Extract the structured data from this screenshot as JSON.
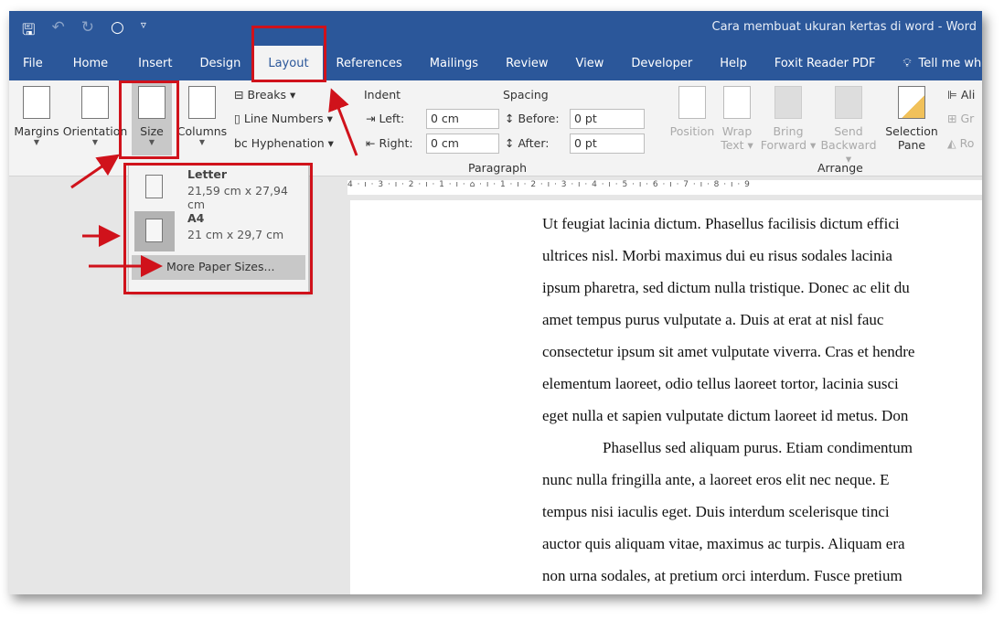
{
  "window": {
    "title": "Cara membuat ukuran kertas di word  -  Word"
  },
  "qat": [
    "save-icon",
    "undo-icon",
    "redo-icon",
    "circle-icon",
    "customize-icon"
  ],
  "tabs": [
    "File",
    "Home",
    "Insert",
    "Design",
    "Layout",
    "References",
    "Mailings",
    "Review",
    "View",
    "Developer",
    "Help",
    "Foxit Reader PDF",
    "Tell me wha"
  ],
  "active_tab": "Layout",
  "ribbon": {
    "margins": "Margins",
    "orientation": "Orientation",
    "size": "Size",
    "columns": "Columns",
    "breaks": "Breaks ▾",
    "line_numbers": "Line Numbers ▾",
    "hyphenation": "Hyphenation ▾",
    "indent": "Indent",
    "left_label": "Left:",
    "left_value": "0 cm",
    "right_label": "Right:",
    "right_value": "0 cm",
    "spacing": "Spacing",
    "before_label": "Before:",
    "before_value": "0 pt",
    "after_label": "After:",
    "after_value": "0 pt",
    "paragraph_group": "Paragraph",
    "position": "Position",
    "wrap": "Wrap",
    "wrap2": "Text ▾",
    "bring": "Bring",
    "bring2": "Forward ▾",
    "send": "Send",
    "send2": "Backward ▾",
    "selection": "Selection",
    "selection2": "Pane",
    "align": "Ali",
    "group": "Gr",
    "rotate": "Ro",
    "arrange_group": "Arrange"
  },
  "ruler": "4 · ı · 3 · ı · 2 · ı · 1 · ı · ⌂ · ı · 1 · ı · 2 · ı · 3 · ı · 4 · ı · 5 · ı · 6 · ı · 7 · ı · 8 · ı · 9",
  "size_menu": {
    "items": [
      {
        "name": "Letter",
        "dims": "21,59 cm x 27,94 cm"
      },
      {
        "name": "A4",
        "dims": "21 cm x 29,7 cm"
      }
    ],
    "more": "More Paper Sizes..."
  },
  "document": {
    "lines": [
      "Ut feugiat lacinia dictum. Phasellus facilisis dictum effici",
      "ultrices nisl. Morbi maximus dui eu risus sodales lacinia",
      "ipsum pharetra, sed dictum nulla tristique. Donec ac elit du",
      "amet tempus purus vulputate a. Duis at erat at nisl fauc",
      "consectetur ipsum sit amet vulputate viverra. Cras et hendre",
      "elementum laoreet, odio tellus laoreet tortor, lacinia susci",
      "eget nulla et sapien vulputate dictum laoreet id metus. Don",
      "Phasellus sed aliquam purus. Etiam condimentum",
      "nunc nulla fringilla ante, a laoreet eros elit nec neque. E",
      "tempus nisi iaculis eget. Duis interdum scelerisque tinci",
      "auctor quis aliquam vitae, maximus ac turpis. Aliquam era",
      "non urna sodales, at pretium orci interdum. Fusce pretium"
    ]
  },
  "colors": {
    "accent": "#2b579a",
    "highlight": "#d0121b"
  }
}
